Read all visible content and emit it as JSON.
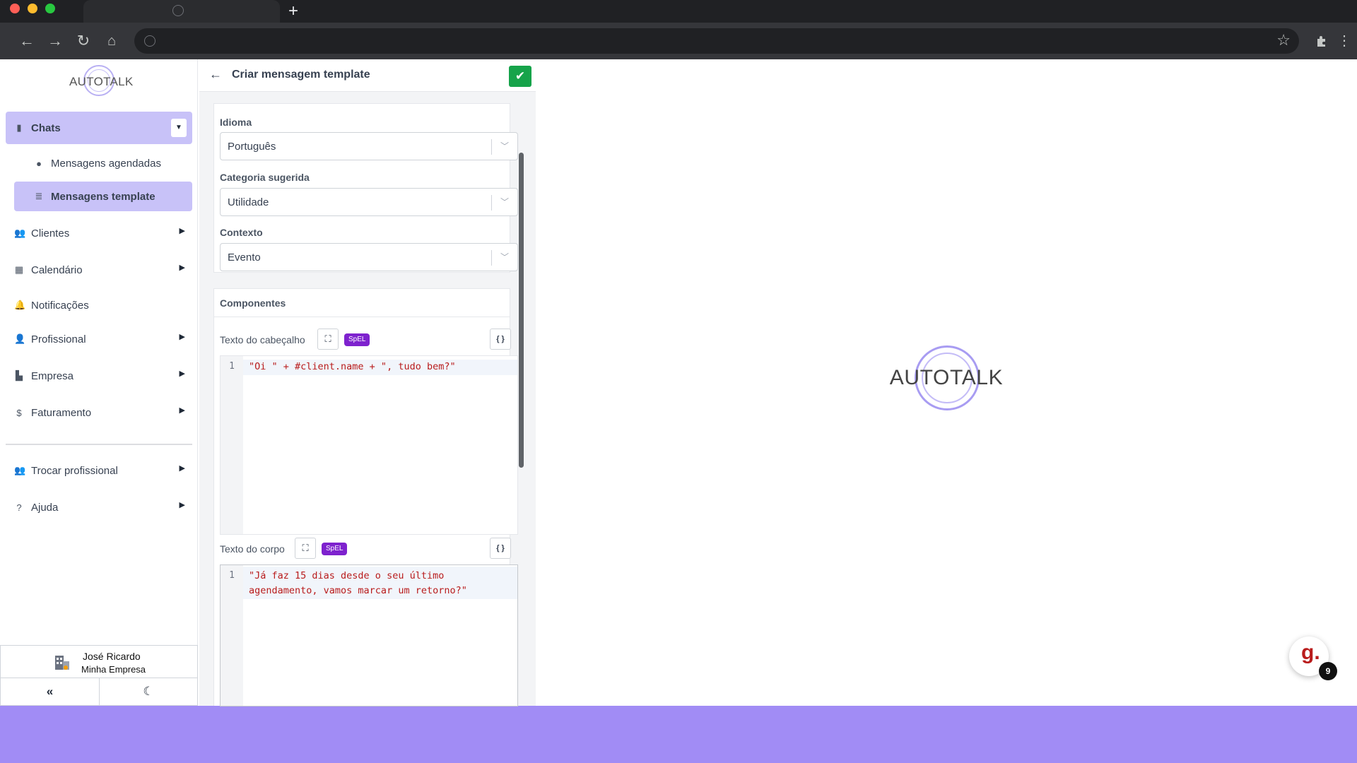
{
  "browser": {
    "new_tab": "+"
  },
  "sidebar": {
    "logo": "AUTOTALK",
    "items": [
      {
        "label": "Chats"
      },
      {
        "label": "Mensagens agendadas"
      },
      {
        "label": "Mensagens template"
      },
      {
        "label": "Clientes"
      },
      {
        "label": "Calendário"
      },
      {
        "label": "Notificações"
      },
      {
        "label": "Profissional"
      },
      {
        "label": "Empresa"
      },
      {
        "label": "Faturamento"
      },
      {
        "label": "Trocar profissional"
      },
      {
        "label": "Ajuda"
      }
    ],
    "user": {
      "name": "José Ricardo",
      "company": "Minha Empresa",
      "collapse": "«",
      "theme": "☾"
    }
  },
  "editor": {
    "title": "Criar mensagem template",
    "fields": [
      {
        "label": "Idioma",
        "value": "Português"
      },
      {
        "label": "Categoria sugerida",
        "value": "Utilidade"
      },
      {
        "label": "Contexto",
        "value": "Evento"
      }
    ],
    "components_title": "Componentes",
    "header_label": "Texto do cabeçalho",
    "body_label": "Texto do corpo",
    "spel_badge": "SpEL",
    "braces": "{ }",
    "header_code": {
      "line": "1",
      "text": "\"Oi \" + #client.name + \", tudo bem?\""
    },
    "body_code": {
      "line": "1",
      "text_1": "\"Já faz 15 dias desde o seu último",
      "text_2": "agendamento, vamos marcar um retorno?\""
    }
  },
  "main_logo": "AUTOTALK",
  "chat_widget": {
    "glyph": "g.",
    "badge": "9"
  },
  "colors": {
    "accent": "#c8c2f8",
    "background_band": "#a18cf5",
    "save": "#16a34a",
    "spel": "#7e22ce"
  }
}
